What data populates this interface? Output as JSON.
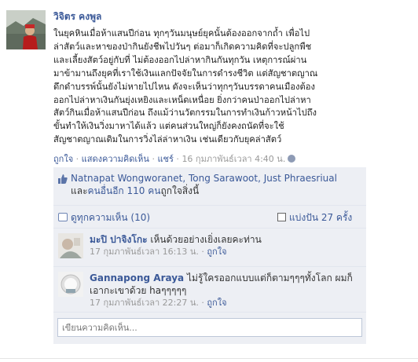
{
  "post": {
    "author": "วิจิตร คงพูล",
    "text_lines": [
      "ในยุคหินเมื่อห้าแสนปีก่อน ทุกๆวันมนุษย์ยุคนั้นต้องออกจากถ้ำ เพื่อไป",
      "ล่าสัตว์และหาของป่ากินยังชีพไปวันๆ ต่อมาก็เกิดความคิดที่จะปลูกพืช",
      "และเลี้ยงสัตว์อยู่กับที่ ไม่ต้องออกไปล่าหากินกันทุกวัน เหตุการณ์ผ่าน",
      "มาข้ามานถึงยุคที่เราใช้เงินแลกปัจจัยในการดำรงชีวิต แต่สัญชาตญาณ",
      "ดึกดำบรรพ์นั้นยังไม่หายไปไหน ดังจะเห็นว่าทุกๆวันบรรดาคนเมืองต้อง",
      "ออกไปล่าหาเงินกันยุ่งเหยิงและเหน็ดเหนื่อย ยิ่งกว่าคนป่าออกไปล่าหา",
      "สัตว์กินเมื่อห้าแสนปีก่อน ถึงแม้ว่านวัตกรรมในการทำเงินก้าวหน้าไปถึง",
      "ขั้นทำให้เงินวิ่งมาหาได้แล้ว แต่คนส่วนใหญ่ก็ยังคงถนัดที่จะใช้",
      "สัญชาตญาณเดิมในการวิ่งไล่ล่าหาเงิน เช่นเดียวกับยุคล่าสัตว์"
    ],
    "like_action": "ถูกใจ",
    "comment_action": "แสดงความคิดเห็น",
    "share_action": "แชร์",
    "separator": " · ",
    "timestamp": "16 กุมภาพันธ์เวลา 4:40 น.",
    "globe_icon": "globe-icon"
  },
  "likes": {
    "names": "Natnapat Wongworanet, Tong Sarawoot, Just Phraesriual",
    "and_text": " และ",
    "others_link": "คนอื่นอีก 110 คน",
    "suffix": "ถูกใจสิ่งนี้"
  },
  "view_all": {
    "label": "ดูทุกความเห็น (10)"
  },
  "shares": {
    "label": "แบ่งปัน 27 ครั้ง"
  },
  "comments": [
    {
      "author": "มะปิ ปาจิงโกะ",
      "text": " เห็นด้วยอย่างเยิ่งเลยคะท่าน",
      "timestamp": "17 กุมภาพันธ์เวลา 16:13 น.",
      "like_label": "ถูกใจ"
    },
    {
      "author": "Gannapong Araya",
      "text": " ไม่รู้ใครออกแบบแต่ก็ตามๆๆๆทั้งโลก ผมก็เอากะเขาด้วย haๆๆๆๆๆ",
      "timestamp": "17 กุมภาพันธ์เวลา 22:27 น.",
      "like_label": "ถูกใจ"
    }
  ],
  "comment_box": {
    "placeholder": "เขียนความคิดเห็น..."
  },
  "colors": {
    "link": "#3b5998",
    "feedback_bg": "#edeff4",
    "muted": "#999999"
  }
}
